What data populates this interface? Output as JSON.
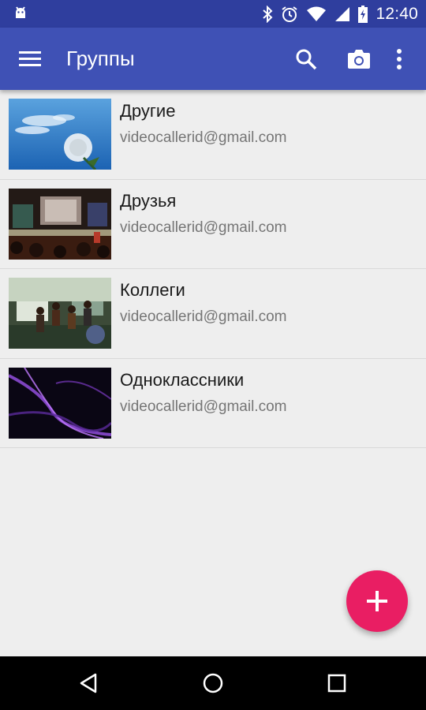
{
  "status_bar": {
    "time": "12:40",
    "icons": [
      "android-debug-icon",
      "bluetooth-icon",
      "alarm-icon",
      "wifi-icon",
      "signal-icon",
      "battery-icon"
    ]
  },
  "toolbar": {
    "title": "Группы",
    "background": "#3f51b5",
    "actions": [
      "menu-icon",
      "search-icon",
      "camera-icon",
      "more-vert-icon"
    ]
  },
  "groups": [
    {
      "name": "Другие",
      "email": "videocallerid@gmail.com",
      "thumbnail": "dandelion-sky"
    },
    {
      "name": "Друзья",
      "email": "videocallerid@gmail.com",
      "thumbnail": "concert-stage"
    },
    {
      "name": "Коллеги",
      "email": "videocallerid@gmail.com",
      "thumbnail": "people-outdoors"
    },
    {
      "name": "Одноклассники",
      "email": "videocallerid@gmail.com",
      "thumbnail": "purple-light-waves"
    }
  ],
  "fab": {
    "icon": "plus-icon",
    "color": "#e91e63"
  },
  "nav_bar": {
    "icons": [
      "back-icon",
      "home-icon",
      "recents-icon"
    ]
  }
}
